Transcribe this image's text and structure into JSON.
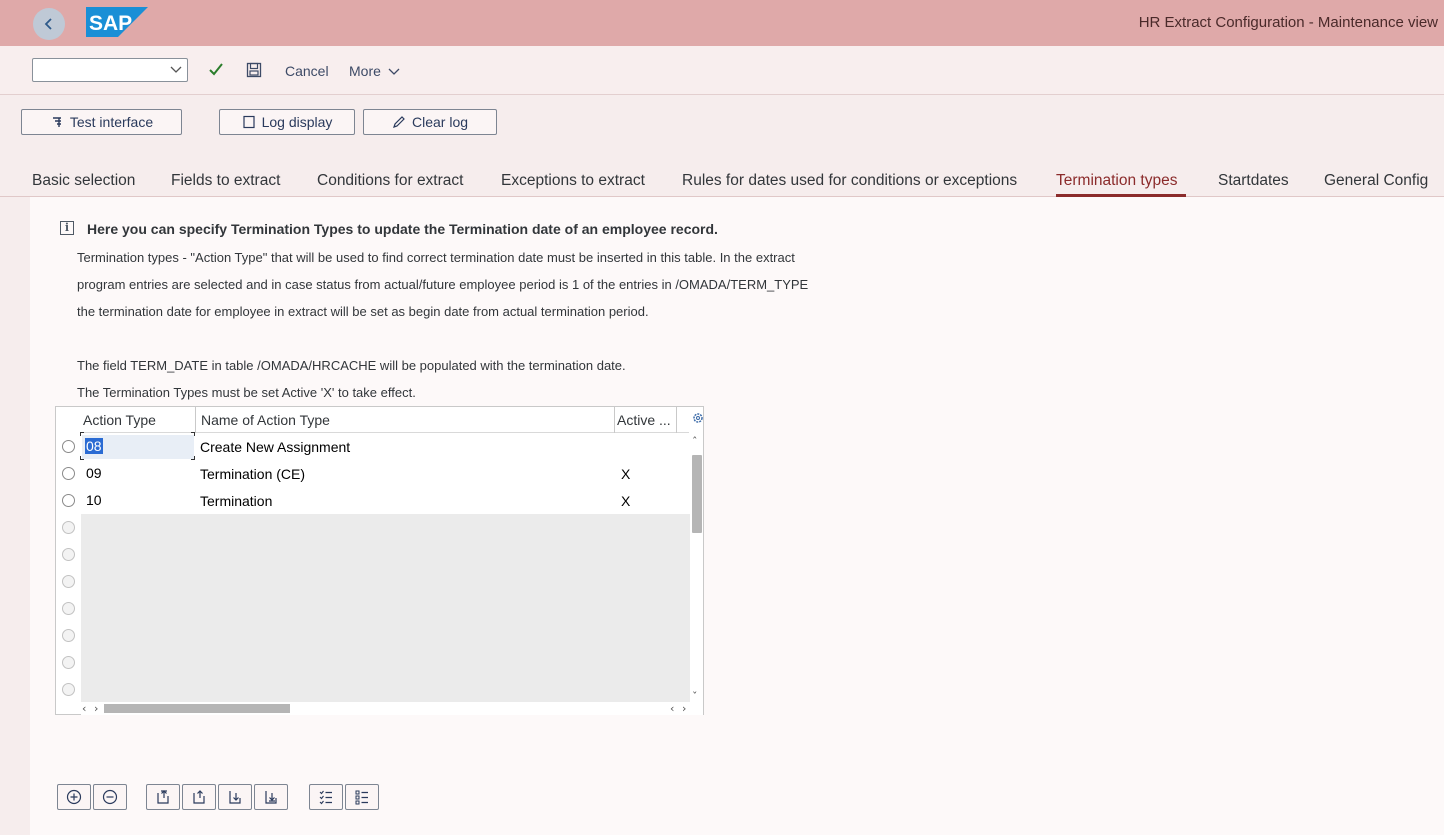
{
  "shell": {
    "logo_text": "SAP",
    "title": "HR Extract Configuration - Maintenance view"
  },
  "toolbar": {
    "select_value": "",
    "cancel_label": "Cancel",
    "more_label": "More"
  },
  "actions": {
    "test_interface": "Test interface",
    "log_display": "Log display",
    "clear_log": "Clear log"
  },
  "tabs": [
    {
      "label": "Basic selection"
    },
    {
      "label": "Fields to extract"
    },
    {
      "label": "Conditions for extract"
    },
    {
      "label": "Exceptions to extract"
    },
    {
      "label": "Rules for dates used for conditions or exceptions"
    },
    {
      "label": "Termination types",
      "active": true
    },
    {
      "label": "Startdates"
    },
    {
      "label": "General Config"
    }
  ],
  "info": {
    "heading": "Here you can specify Termination Types to update the Termination date of an employee record.",
    "lines": [
      "Termination types - \"Action Type\" that will be used to find correct termination date must be inserted in this table. In the extract",
      " program entries are selected and in case status from actual/future employee period is 1 of the entries in /OMADA/TERM_TYPE",
      "the termination date for employee in extract will be set as begin date from actual termination period.",
      " The field TERM_DATE in table /OMADA/HRCACHE will be populated with the termination date.",
      "The Termination Types must be set Active 'X' to take effect."
    ]
  },
  "table": {
    "columns": [
      "Action Type",
      "Name of Action Type",
      "Active ..."
    ],
    "rows": [
      {
        "action_type": "08",
        "name": "Create New Assignment",
        "active": ""
      },
      {
        "action_type": "09",
        "name": "Termination (CE)",
        "active": "X"
      },
      {
        "action_type": "10",
        "name": "Termination",
        "active": "X"
      }
    ],
    "empty_rows": 7
  },
  "bottom_icons": [
    "add-row-icon",
    "remove-row-icon",
    "move-top-icon",
    "move-up-icon",
    "move-down-icon",
    "move-bottom-icon",
    "select-all-icon",
    "deselect-all-icon"
  ],
  "colors": {
    "shell_bg": "#dfa9a9",
    "active_tab": "#8b2b2b",
    "check_green": "#2b7d2b"
  }
}
